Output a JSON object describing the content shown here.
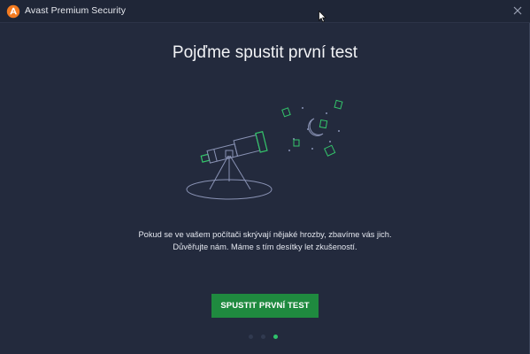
{
  "window": {
    "title": "Avast Premium Security",
    "logo_icon": "avast-logo-icon",
    "close_icon": "close-icon"
  },
  "main": {
    "heading": "Pojďme spustit první test",
    "description_line1": "Pokud se ve vašem počítači skrývají nějaké hrozby, zbavíme vás jich.",
    "description_line2": "Důvěřujte nám. Máme s tím desítky let zkušeností.",
    "cta_label": "SPUSTIT PRVNÍ TEST",
    "illustration_icon": "telescope-icon"
  },
  "pagination": {
    "total": 3,
    "current": 3
  },
  "colors": {
    "background": "#232a3d",
    "titlebar": "#1f2637",
    "accent_green": "#1f8a3f",
    "dot_active": "#2fc26b",
    "brand_orange": "#f47b20"
  }
}
